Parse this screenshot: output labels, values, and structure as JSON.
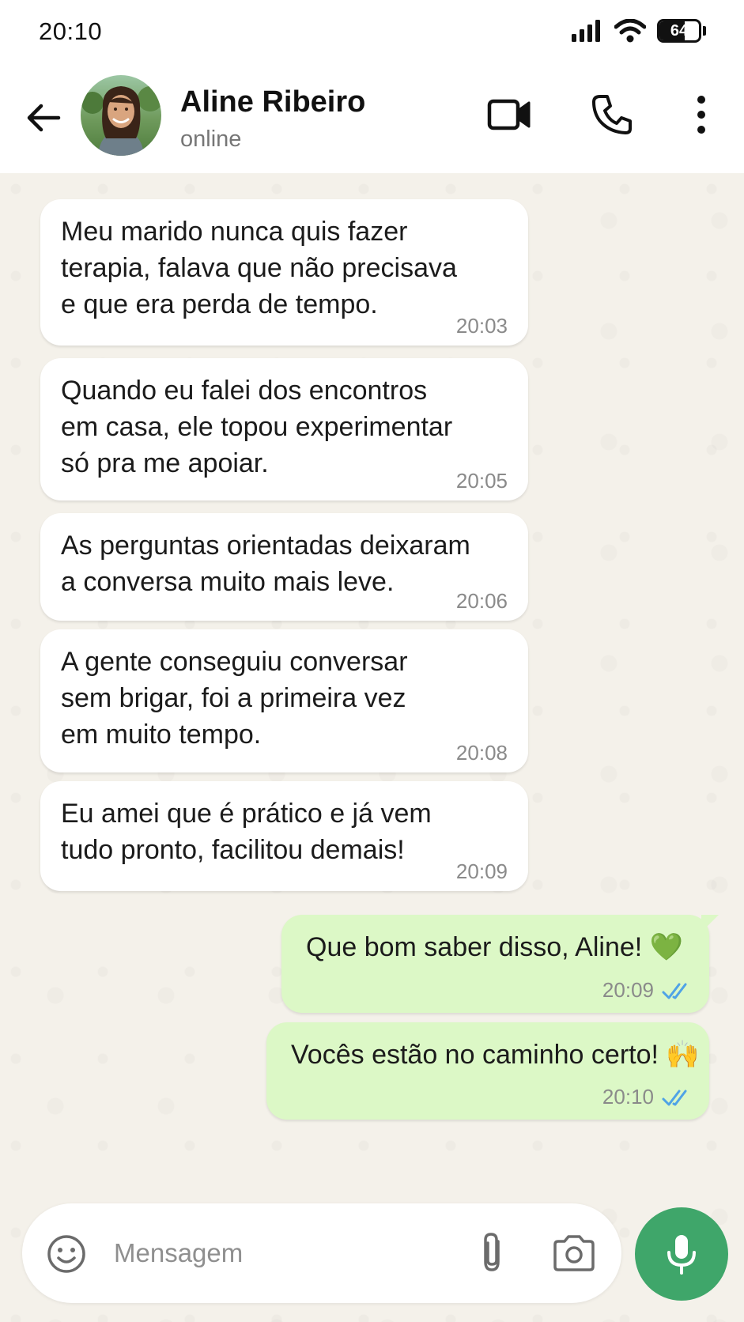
{
  "status_bar": {
    "time": "20:10",
    "battery_level": "64",
    "battery_fraction": 0.64
  },
  "header": {
    "contact_name": "Aline Ribeiro",
    "contact_status": "online",
    "icons": [
      "back-arrow-icon",
      "avatar",
      "video-call-icon",
      "phone-icon",
      "more-vertical-icon"
    ]
  },
  "messages": [
    {
      "direction": "in",
      "text": "Meu marido nunca quis fazer\nterapia, falava que não precisava\ne que era perda de tempo.",
      "time": "20:03"
    },
    {
      "direction": "in",
      "text": "Quando eu falei dos encontros\nem casa, ele topou experimentar\nsó pra me apoiar.",
      "time": "20:05"
    },
    {
      "direction": "in",
      "text": "As perguntas orientadas deixaram\na conversa muito mais leve.",
      "time": "20:06"
    },
    {
      "direction": "in",
      "text": "A gente conseguiu conversar\nsem brigar, foi a primeira vez\nem muito tempo.",
      "time": "20:08"
    },
    {
      "direction": "in",
      "text": "Eu amei que é prático e já vem\ntudo pronto, facilitou demais!",
      "time": "20:09"
    },
    {
      "direction": "out",
      "text": "Que bom saber disso, Aline! 💚",
      "time": "20:09",
      "status": "read"
    },
    {
      "direction": "out",
      "text": "Vocês estão no caminho certo! 🙌",
      "time": "20:10",
      "status": "read"
    }
  ],
  "composer": {
    "placeholder": "Mensagem",
    "value": ""
  },
  "colors": {
    "incoming_bubble": "#ffffff",
    "outgoing_bubble": "#dcf8c6",
    "chat_background": "#f4f1ea",
    "mic_button": "#3fa66a",
    "read_ticks": "#4fa3e6"
  }
}
